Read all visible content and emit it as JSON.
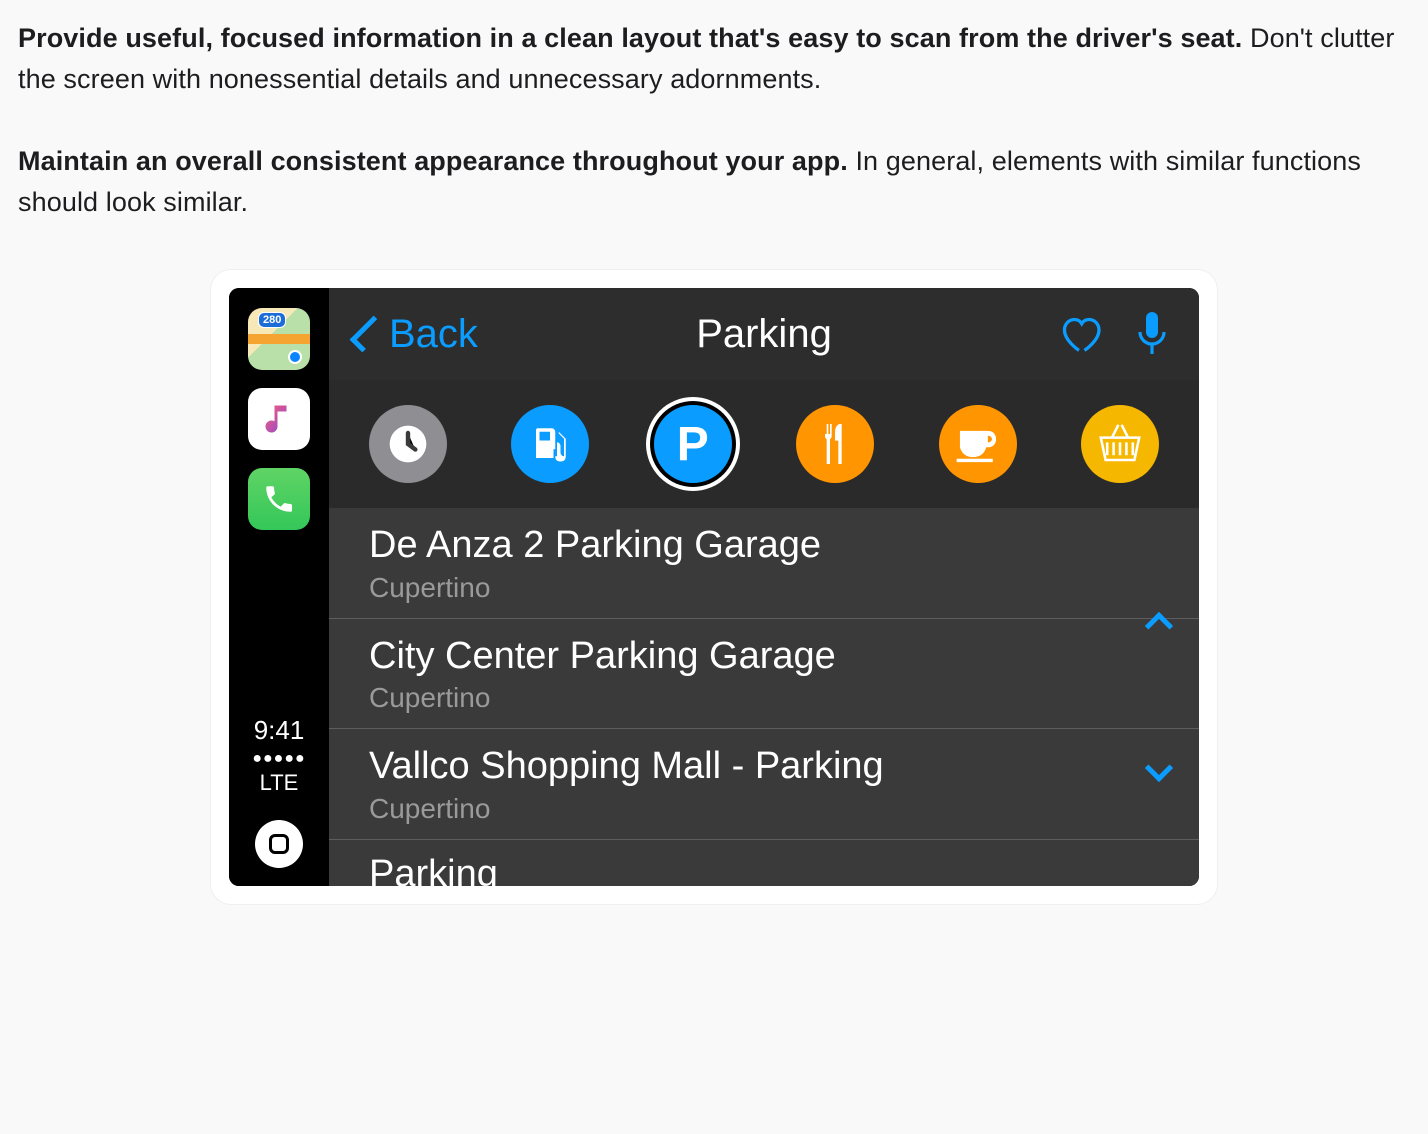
{
  "doc": {
    "para1_bold": "Provide useful, focused information in a clean layout that's easy to scan from the driver's seat.",
    "para1_rest": " Don't clutter the screen with nonessential details and unnecessary adornments.",
    "para2_bold": "Maintain an overall consistent appearance throughout your app.",
    "para2_rest": " In general, elements with similar functions should look similar."
  },
  "sidebar": {
    "time": "9:41",
    "signal_dots": "●●●●●",
    "network": "LTE"
  },
  "navbar": {
    "back_label": "Back",
    "title": "Parking"
  },
  "categories": [
    {
      "name": "recent",
      "color": "gray"
    },
    {
      "name": "gas",
      "color": "blue"
    },
    {
      "name": "parking",
      "color": "blue",
      "selected": true,
      "letter": "P"
    },
    {
      "name": "food",
      "color": "orange"
    },
    {
      "name": "coffee",
      "color": "orange"
    },
    {
      "name": "shopping",
      "color": "yellow"
    }
  ],
  "results": [
    {
      "title": "De Anza 2 Parking Garage",
      "subtitle": "Cupertino"
    },
    {
      "title": "City Center Parking Garage",
      "subtitle": "Cupertino"
    },
    {
      "title": "Vallco Shopping Mall - Parking",
      "subtitle": "Cupertino"
    }
  ],
  "results_partial": "Parking"
}
